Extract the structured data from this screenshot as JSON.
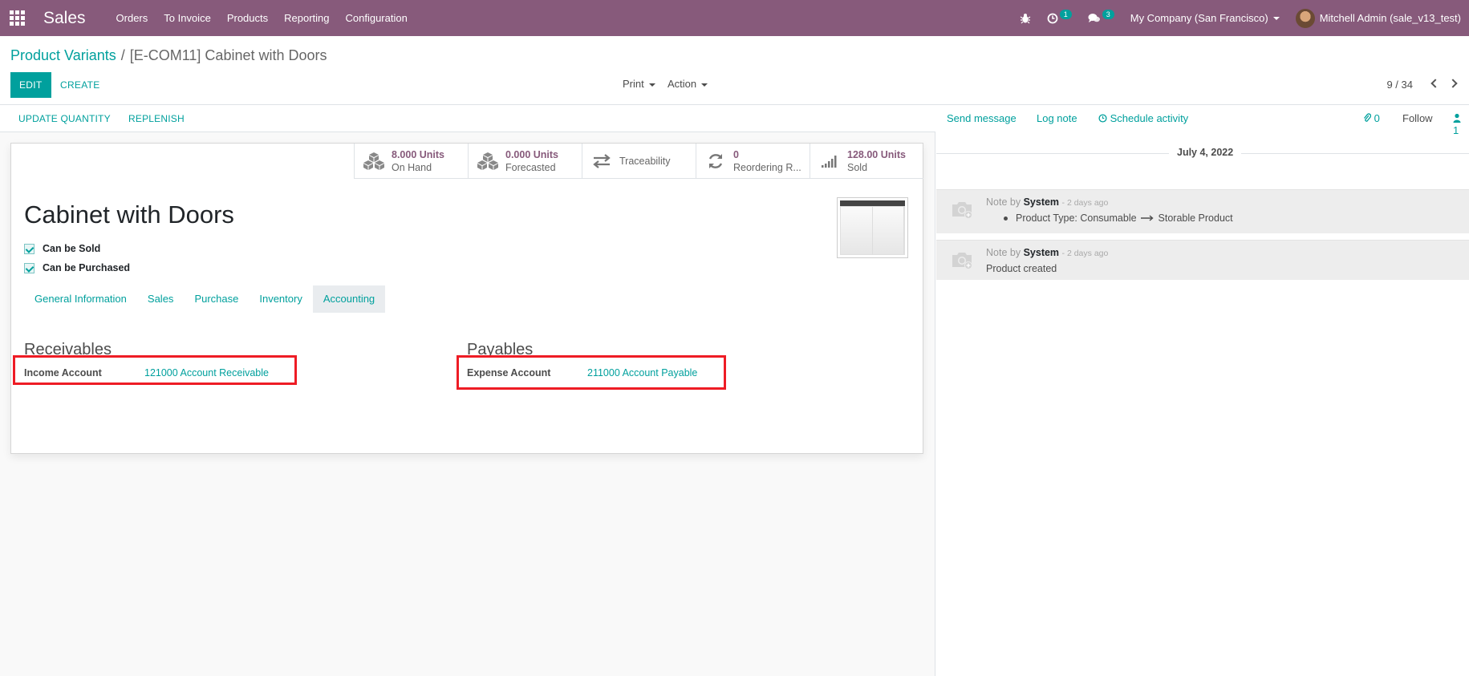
{
  "navbar": {
    "brand": "Sales",
    "menu": [
      "Orders",
      "To Invoice",
      "Products",
      "Reporting",
      "Configuration"
    ],
    "activity_count": "1",
    "message_count": "3",
    "company": "My Company (San Francisco)",
    "user": "Mitchell Admin (sale_v13_test)",
    "bg_color": "#875a7b"
  },
  "control_panel": {
    "breadcrumb_parent": "Product Variants",
    "breadcrumb_separator": "/",
    "breadcrumb_current": "[E-COM11] Cabinet with Doors",
    "edit_label": "EDIT",
    "create_label": "CREATE",
    "print_label": "Print",
    "action_label": "Action",
    "pager": "9 / 34"
  },
  "statusbar": {
    "update_quantity": "UPDATE QUANTITY",
    "replenish": "REPLENISH"
  },
  "smart_buttons": {
    "on_hand": {
      "value": "8.000 Units",
      "label": "On Hand",
      "icon": "cubes-icon"
    },
    "forecasted": {
      "value": "0.000 Units",
      "label": "Forecasted",
      "icon": "cubes-icon"
    },
    "traceability": {
      "label": "Traceability",
      "icon": "exchange-icon"
    },
    "reordering": {
      "value": "0",
      "label": "Reordering R...",
      "icon": "refresh-icon"
    },
    "sold": {
      "value": "128.00 Units",
      "label": "Sold",
      "icon": "signal-icon"
    }
  },
  "product": {
    "name": "Cabinet with Doors",
    "can_be_sold_label": "Can be Sold",
    "can_be_sold": true,
    "can_be_purchased_label": "Can be Purchased",
    "can_be_purchased": true
  },
  "tabs": [
    {
      "label": "General Information",
      "active": false
    },
    {
      "label": "Sales",
      "active": false
    },
    {
      "label": "Purchase",
      "active": false
    },
    {
      "label": "Inventory",
      "active": false
    },
    {
      "label": "Accounting",
      "active": true
    }
  ],
  "accounting": {
    "receivables_title": "Receivables",
    "income_account_label": "Income Account",
    "income_account_value": "121000 Account Receivable",
    "payables_title": "Payables",
    "expense_account_label": "Expense Account",
    "expense_account_value": "211000 Account Payable",
    "highlight_color": "#ee1c25"
  },
  "chatter": {
    "send_message": "Send message",
    "log_note": "Log note",
    "schedule_activity": "Schedule activity",
    "attachments_count": "0",
    "follow_label": "Follow",
    "followers_count": "1",
    "date": "July 4, 2022",
    "messages": [
      {
        "prefix": "Note by",
        "author": "System",
        "ago": "- 2 days ago",
        "body_from": "Product Type: Consumable",
        "body_to": "Storable Product"
      },
      {
        "prefix": "Note by",
        "author": "System",
        "ago": "- 2 days ago",
        "body": "Product created"
      }
    ]
  },
  "accent_color": "#00a09d"
}
